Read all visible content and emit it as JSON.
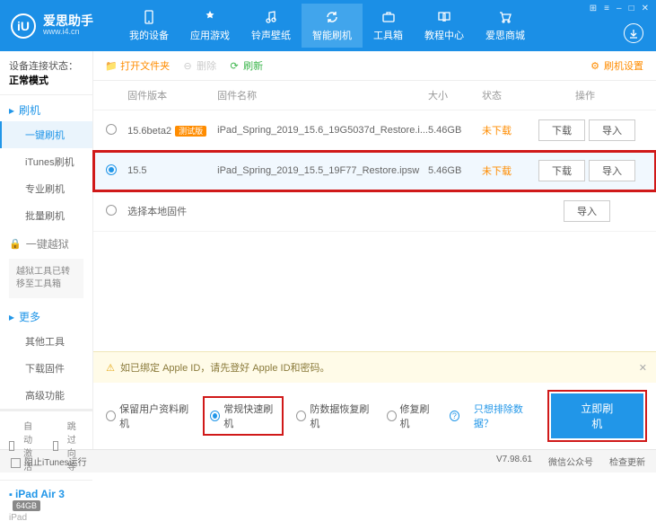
{
  "brand": {
    "name": "爱思助手",
    "url": "www.i4.cn",
    "logo_letter": "iU"
  },
  "nav": [
    {
      "label": "我的设备"
    },
    {
      "label": "应用游戏"
    },
    {
      "label": "铃声壁纸"
    },
    {
      "label": "智能刷机"
    },
    {
      "label": "工具箱"
    },
    {
      "label": "教程中心"
    },
    {
      "label": "爱思商城"
    }
  ],
  "conn_status": {
    "prefix": "设备连接状态：",
    "value": "正常模式"
  },
  "side": {
    "flash_title": "刷机",
    "items": [
      "一键刷机",
      "iTunes刷机",
      "专业刷机",
      "批量刷机"
    ],
    "jailbreak_title": "一键越狱",
    "jailbreak_note": "越狱工具已转移至工具箱",
    "more_title": "更多",
    "more_items": [
      "其他工具",
      "下载固件",
      "高级功能"
    ],
    "auto_activate": "自动激活",
    "skip_guide": "跳过向导"
  },
  "device": {
    "name": "iPad Air 3",
    "storage": "64GB",
    "type": "iPad"
  },
  "toolbar": {
    "open_folder": "打开文件夹",
    "delete": "删除",
    "refresh": "刷新",
    "settings": "刷机设置"
  },
  "cols": {
    "ver": "固件版本",
    "name": "固件名称",
    "size": "大小",
    "status": "状态",
    "ops": "操作"
  },
  "rows": [
    {
      "ver": "15.6beta2",
      "beta": "测试版",
      "fname": "iPad_Spring_2019_15.6_19G5037d_Restore.i...",
      "size": "5.46GB",
      "status": "未下载"
    },
    {
      "ver": "15.5",
      "fname": "iPad_Spring_2019_15.5_19F77_Restore.ipsw",
      "size": "5.46GB",
      "status": "未下载"
    }
  ],
  "local_fw": "选择本地固件",
  "btns": {
    "download": "下载",
    "import": "导入"
  },
  "warning": "如已绑定 Apple ID，请先登好 Apple ID和密码。",
  "opts": {
    "keep_data": "保留用户资料刷机",
    "normal": "常规快速刷机",
    "anti_recovery": "防数据恢复刷机",
    "repair": "修复刷机",
    "exclude_link": "只想排除数据？"
  },
  "flash_btn": "立即刷机",
  "status_bar": {
    "block_itunes": "阻止iTunes运行",
    "version": "V7.98.61",
    "wechat": "微信公众号",
    "check_update": "检查更新"
  }
}
